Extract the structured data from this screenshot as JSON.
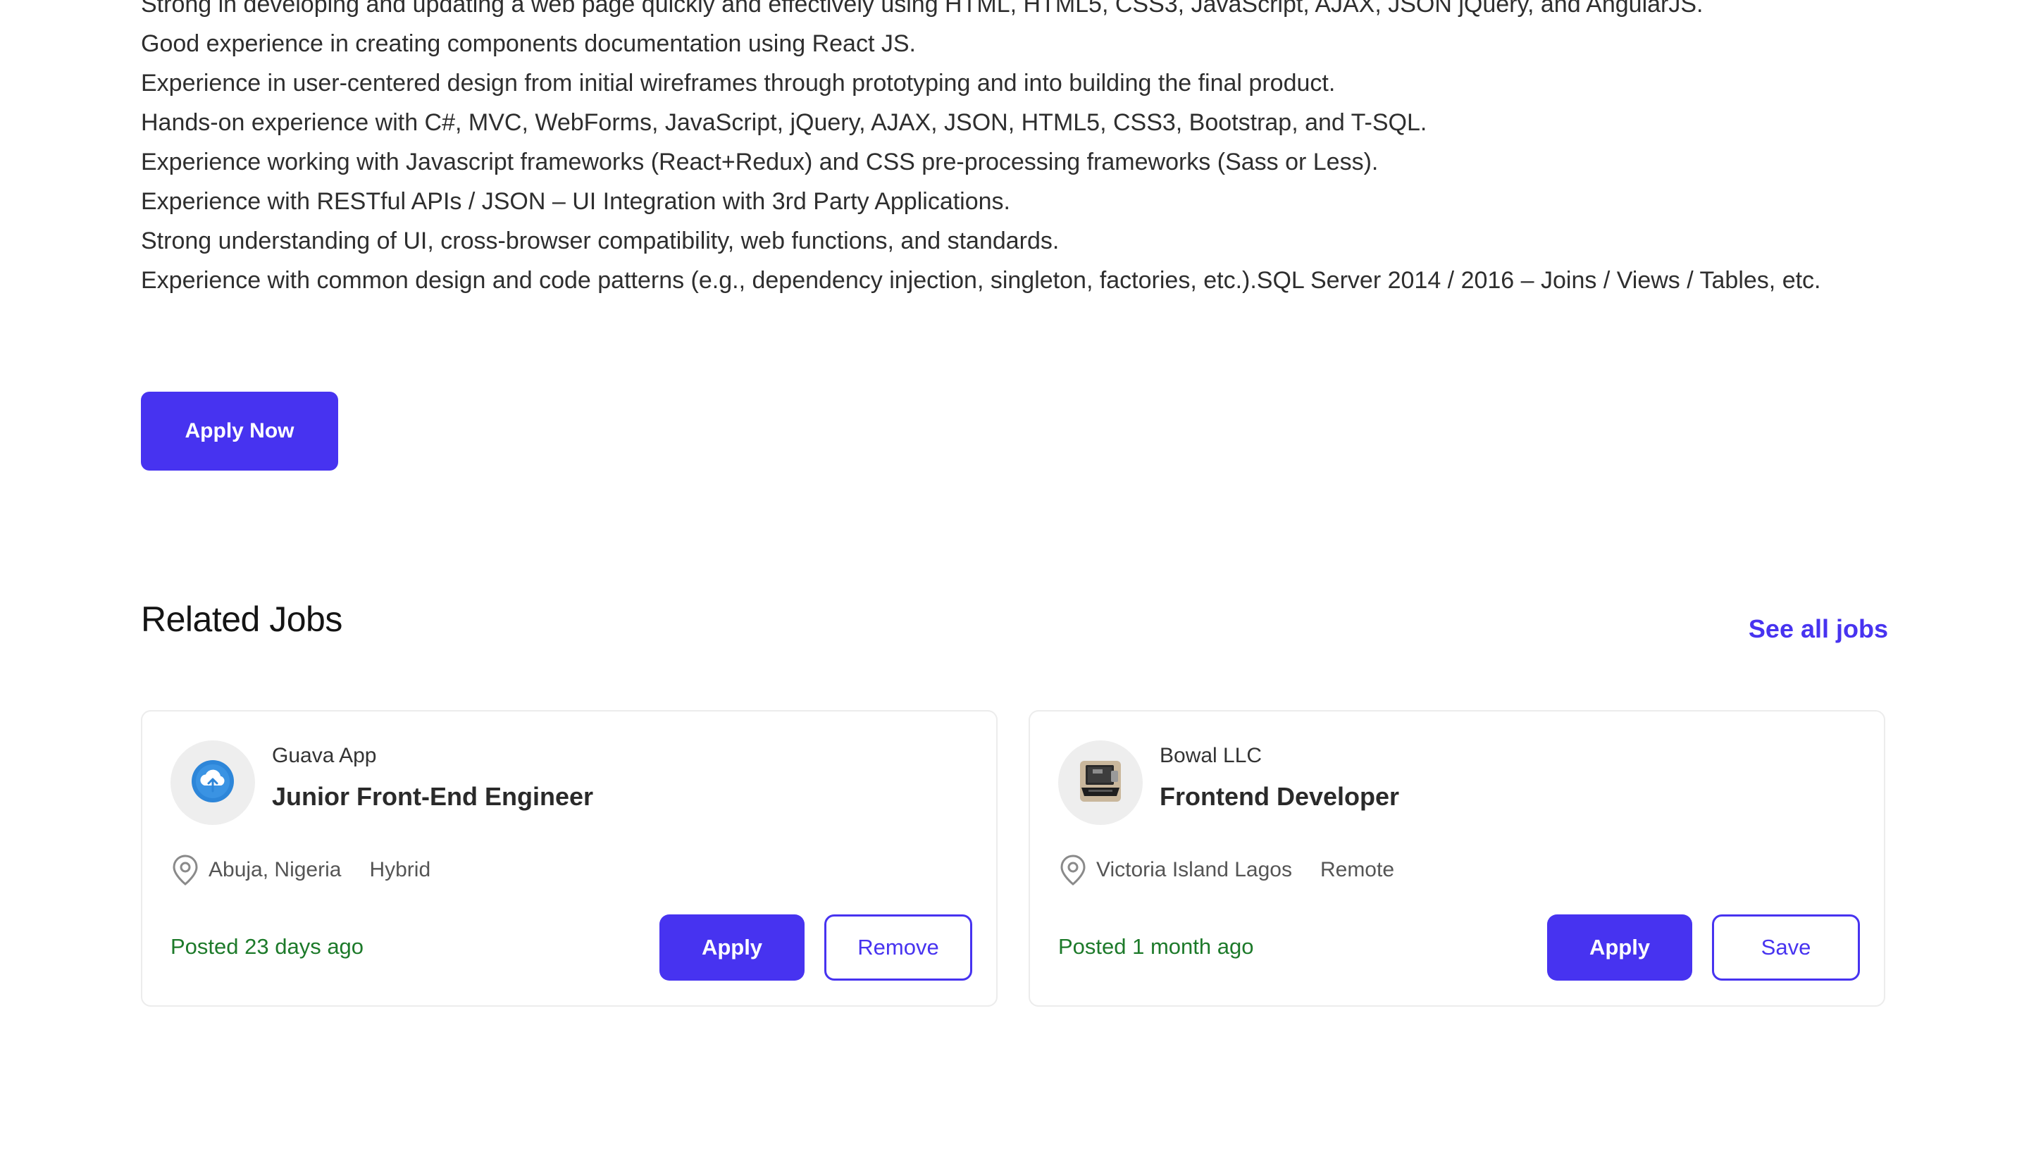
{
  "requirements": [
    "Strong in developing and updating a web page quickly and effectively using HTML, HTML5, CSS3, JavaScript, AJAX, JSON jQuery, and AngularJS.",
    "Good experience in creating components documentation using React JS.",
    "Experience in user-centered design from initial wireframes through prototyping and into building the final product.",
    "Hands-on experience with C#, MVC, WebForms, JavaScript, jQuery, AJAX, JSON, HTML5, CSS3, Bootstrap, and T-SQL.",
    "Experience working with Javascript frameworks (React+Redux) and CSS pre-processing frameworks (Sass or Less).",
    "Experience with RESTful APIs / JSON – UI Integration with 3rd Party Applications.",
    "Strong understanding of UI, cross-browser compatibility, web functions, and standards.",
    "Experience with common design and code patterns (e.g., dependency injection, singleton, factories, etc.).SQL Server 2014 / 2016 – Joins / Views / Tables, etc."
  ],
  "apply_now_label": "Apply Now",
  "related": {
    "title": "Related Jobs",
    "see_all_label": "See all jobs",
    "jobs": [
      {
        "company": "Guava App",
        "title": "Junior Front-End Engineer",
        "location": "Abuja, Nigeria",
        "work_type": "Hybrid",
        "posted": "Posted 23 days ago",
        "apply_label": "Apply",
        "secondary_label": "Remove",
        "logo_icon": "cloud-upload-icon"
      },
      {
        "company": "Bowal LLC",
        "title": "Frontend Developer",
        "location": "Victoria Island Lagos",
        "work_type": "Remote",
        "posted": "Posted 1 month ago",
        "apply_label": "Apply",
        "secondary_label": "Save",
        "logo_icon": "laptop-icon"
      }
    ]
  },
  "colors": {
    "accent": "#4733f0",
    "posted_green": "#1d7a2a",
    "card_border": "#ececec"
  }
}
